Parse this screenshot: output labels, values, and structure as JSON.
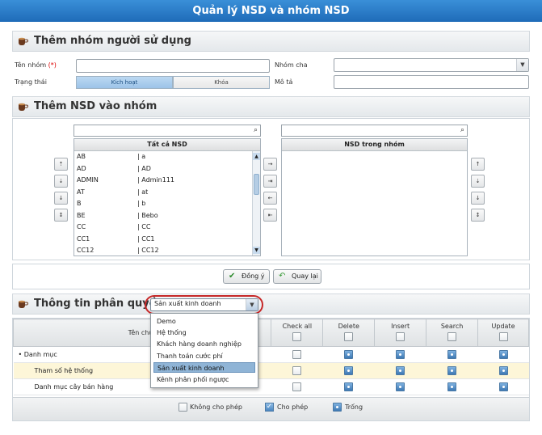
{
  "window": {
    "title": "Quản lý NSD và nhóm NSD"
  },
  "section_group": {
    "title": "Thêm nhóm người sử dụng",
    "name_label": "Tên nhóm",
    "required_mark": "(*)",
    "parent_label": "Nhóm cha",
    "status_label": "Trạng thái",
    "status_active": "Kích hoạt",
    "status_locked": "Khóa",
    "desc_label": "Mô tả",
    "name_value": "",
    "parent_value": "",
    "desc_value": ""
  },
  "section_members": {
    "title": "Thêm NSD vào nhóm",
    "all_users_header": "Tất cả NSD",
    "group_users_header": "NSD trong nhóm",
    "users": [
      {
        "code": "AB",
        "name": "| a"
      },
      {
        "code": "AD",
        "name": "| AD"
      },
      {
        "code": "ADMIN",
        "name": "| Admin111"
      },
      {
        "code": "AT",
        "name": "| at"
      },
      {
        "code": "B",
        "name": "| b"
      },
      {
        "code": "BE",
        "name": "| Bebo"
      },
      {
        "code": "CC",
        "name": "| CC"
      },
      {
        "code": "CC1",
        "name": "| CC1"
      },
      {
        "code": "CC12",
        "name": "| CC12"
      }
    ],
    "left_side_buttons": [
      "⇡",
      "⇣",
      "↓",
      "↕"
    ],
    "transfer_buttons": [
      "→",
      "⇥",
      "←",
      "⇤"
    ],
    "right_side_buttons": [
      "↑",
      "⇣",
      "↓",
      "↕"
    ]
  },
  "actions": {
    "ok": "Đồng ý",
    "back": "Quay lại"
  },
  "section_permissions": {
    "title": "Thông tin phân quyền",
    "module_selected": "Sản xuất kinh doanh",
    "module_options": [
      "Demo",
      "Hệ thống",
      "Khách hàng doanh nghiệp",
      "Thanh toán cước phí",
      "Sản xuất kinh doanh",
      "Kênh phân phối ngược"
    ],
    "columns": {
      "function": "Tên chức",
      "check_all": "Check all",
      "delete": "Delete",
      "insert": "Insert",
      "search": "Search",
      "update": "Update"
    },
    "rows": [
      {
        "name": "Danh mục",
        "bullet": "•"
      },
      {
        "name": "Tham số hệ thống"
      },
      {
        "name": "Danh mục cây bán hàng"
      }
    ],
    "legend": {
      "deny": "Không cho phép",
      "allow": "Cho phép",
      "empty": "Trống"
    }
  },
  "colors": {
    "title_bar": "#2a7cc9",
    "highlight_row": "#fdf6d8",
    "callout": "#c62828"
  }
}
